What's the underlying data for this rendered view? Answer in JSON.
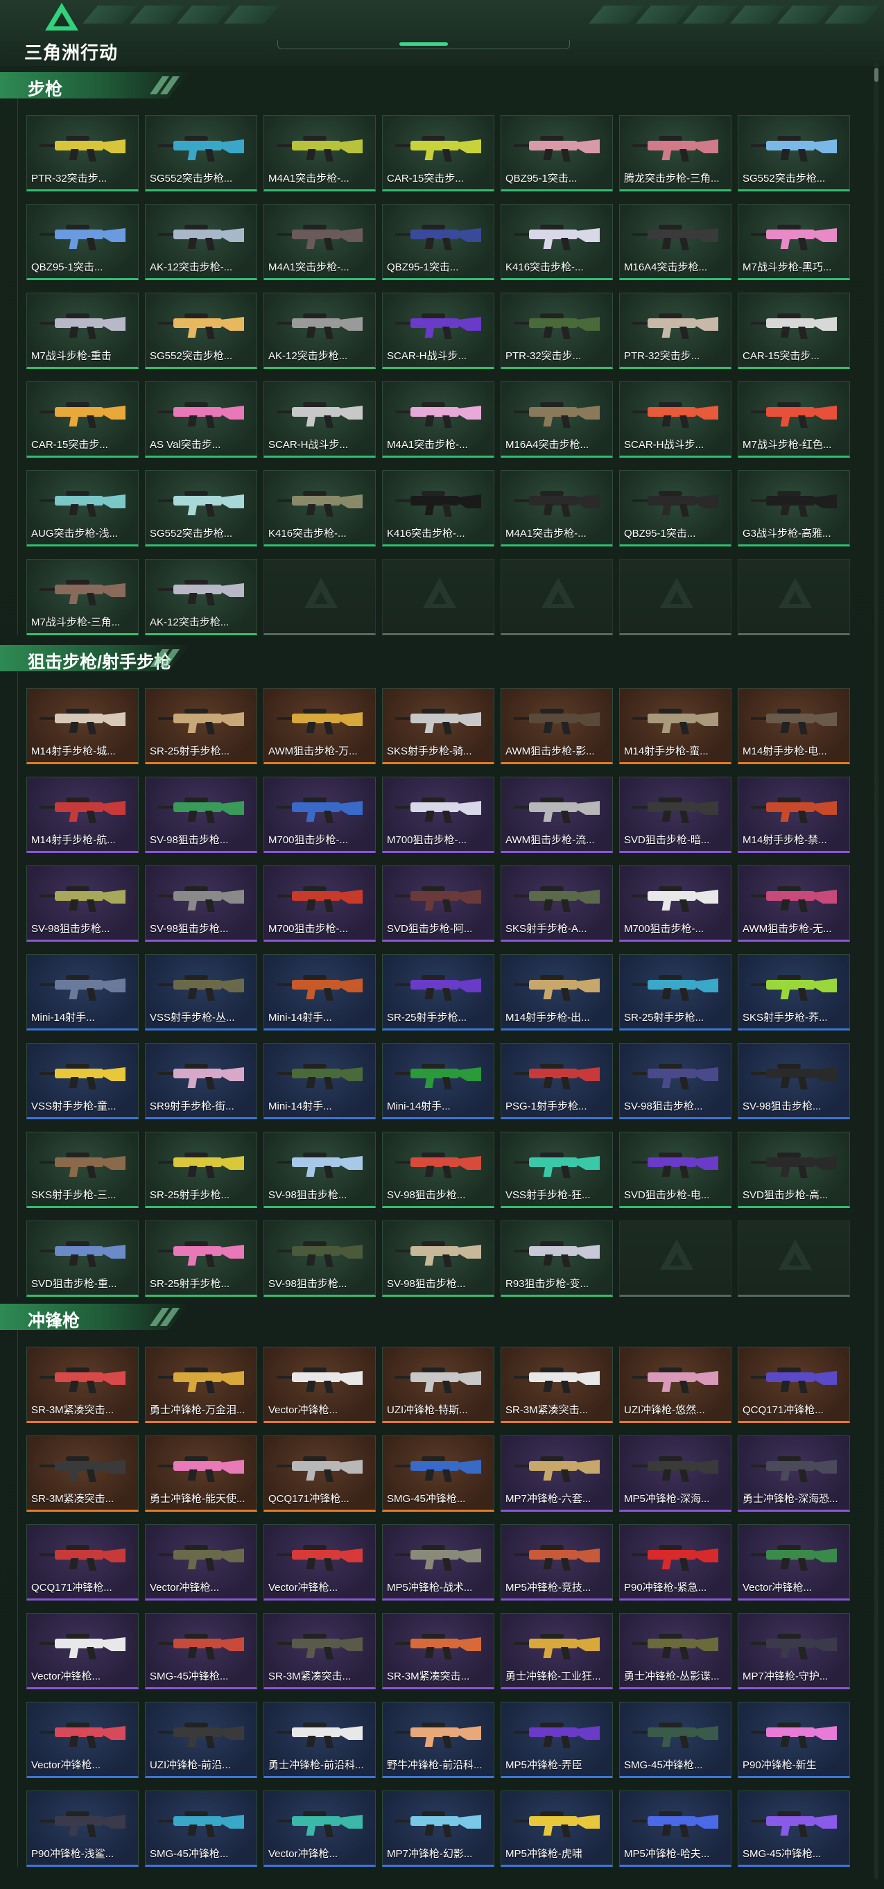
{
  "header": {
    "game_title": "三角洲行动",
    "logo_icon": "delta-triangle-logo-icon"
  },
  "colors": {
    "green": "#2fbf71",
    "orange": "#e67a23",
    "purple": "#8c55d8",
    "blue": "#3a76d8",
    "accent": "#33d17c"
  },
  "sections": [
    {
      "title": "步枪",
      "items": [
        {
          "name": "PTR-32突击步...",
          "rarity": "green",
          "color": "#d8c53a"
        },
        {
          "name": "SG552突击步枪...",
          "rarity": "green",
          "color": "#3aa7c8"
        },
        {
          "name": "M4A1突击步枪-...",
          "rarity": "green",
          "color": "#b8c23a"
        },
        {
          "name": "CAR-15突击步...",
          "rarity": "green",
          "color": "#c8d23a"
        },
        {
          "name": "QBZ95-1突击...",
          "rarity": "green",
          "color": "#d89aa8"
        },
        {
          "name": "腾龙突击步枪-三角...",
          "rarity": "green",
          "color": "#d07a8a"
        },
        {
          "name": "SG552突击步枪...",
          "rarity": "green",
          "color": "#7ab8e8"
        },
        {
          "name": "QBZ95-1突击...",
          "rarity": "green",
          "color": "#6a9ae0"
        },
        {
          "name": "AK-12突击步枪-...",
          "rarity": "green",
          "color": "#a8b8c8"
        },
        {
          "name": "M4A1突击步枪-...",
          "rarity": "green",
          "color": "#6a5a5a"
        },
        {
          "name": "QBZ95-1突击...",
          "rarity": "green",
          "color": "#3a4a9a"
        },
        {
          "name": "K416突击步枪-...",
          "rarity": "green",
          "color": "#d8d8e8"
        },
        {
          "name": "M16A4突击步枪...",
          "rarity": "green",
          "color": "#3a3a3a"
        },
        {
          "name": "M7战斗步枪-黑巧...",
          "rarity": "green",
          "color": "#e88ac8"
        },
        {
          "name": "M7战斗步枪-重击",
          "rarity": "green",
          "color": "#b8b8c8"
        },
        {
          "name": "SG552突击步枪...",
          "rarity": "green",
          "color": "#e8b860"
        },
        {
          "name": "AK-12突击步枪...",
          "rarity": "green",
          "color": "#9a9a9a"
        },
        {
          "name": "SCAR-H战斗步...",
          "rarity": "green",
          "color": "#6a3ac8"
        },
        {
          "name": "PTR-32突击步...",
          "rarity": "green",
          "color": "#4a6a3a"
        },
        {
          "name": "PTR-32突击步...",
          "rarity": "green",
          "color": "#c8b8a8"
        },
        {
          "name": "CAR-15突击步...",
          "rarity": "green",
          "color": "#d8d8d8"
        },
        {
          "name": "CAR-15突击步...",
          "rarity": "green",
          "color": "#e8a83a"
        },
        {
          "name": "AS Val突击步...",
          "rarity": "green",
          "color": "#e878b8"
        },
        {
          "name": "SCAR-H战斗步...",
          "rarity": "green",
          "color": "#c8c8c8"
        },
        {
          "name": "M4A1突击步枪-...",
          "rarity": "green",
          "color": "#e8a8d8"
        },
        {
          "name": "M16A4突击步枪...",
          "rarity": "green",
          "color": "#8a7a5a"
        },
        {
          "name": "SCAR-H战斗步...",
          "rarity": "green",
          "color": "#e85a3a"
        },
        {
          "name": "M7战斗步枪-红色...",
          "rarity": "green",
          "color": "#e8503a"
        },
        {
          "name": "AUG突击步枪-浅...",
          "rarity": "green",
          "color": "#7ac8c8"
        },
        {
          "name": "SG552突击步枪...",
          "rarity": "green",
          "color": "#a8d8d8"
        },
        {
          "name": "K416突击步枪-...",
          "rarity": "green",
          "color": "#8a8a6a"
        },
        {
          "name": "K416突击步枪-...",
          "rarity": "green",
          "color": "#1a1a1a"
        },
        {
          "name": "M4A1突击步枪-...",
          "rarity": "green",
          "color": "#2a2a2a"
        },
        {
          "name": "QBZ95-1突击...",
          "rarity": "green",
          "color": "#2a2a2a"
        },
        {
          "name": "G3战斗步枪-高雅...",
          "rarity": "green",
          "color": "#1e1e1e"
        },
        {
          "name": "M7战斗步枪-三角...",
          "rarity": "green",
          "color": "#8a6a5a"
        },
        {
          "name": "AK-12突击步枪...",
          "rarity": "green",
          "color": "#b8b8c8"
        },
        {
          "empty": true
        },
        {
          "empty": true
        },
        {
          "empty": true
        },
        {
          "empty": true
        },
        {
          "empty": true
        }
      ]
    },
    {
      "title": "狙击步枪/射手步枪",
      "items": [
        {
          "name": "M14射手步枪-城...",
          "rarity": "orange",
          "color": "#d8c8b8"
        },
        {
          "name": "SR-25射手步枪...",
          "rarity": "orange",
          "color": "#c8a878"
        },
        {
          "name": "AWM狙击步枪-万...",
          "rarity": "orange",
          "color": "#d8a83a"
        },
        {
          "name": "SKS射手步枪-骑...",
          "rarity": "orange",
          "color": "#c8c8c8"
        },
        {
          "name": "AWM狙击步枪-影...",
          "rarity": "orange",
          "color": "#5a4a3a"
        },
        {
          "name": "M14射手步枪-蛮...",
          "rarity": "orange",
          "color": "#a89a7a"
        },
        {
          "name": "M14射手步枪-电...",
          "rarity": "orange",
          "color": "#6a5a4a"
        },
        {
          "name": "M14射手步枪-航...",
          "rarity": "purple",
          "color": "#c83a3a"
        },
        {
          "name": "SV-98狙击步枪...",
          "rarity": "purple",
          "color": "#3a9a5a"
        },
        {
          "name": "M700狙击步枪-...",
          "rarity": "purple",
          "color": "#3a6ac8"
        },
        {
          "name": "M700狙击步枪-...",
          "rarity": "purple",
          "color": "#d8d8e8"
        },
        {
          "name": "AWM狙击步枪-流...",
          "rarity": "purple",
          "color": "#b8b8b8"
        },
        {
          "name": "SVD狙击步枪-暗...",
          "rarity": "purple",
          "color": "#3a3a3a"
        },
        {
          "name": "M14射手步枪-禁...",
          "rarity": "purple",
          "color": "#c84a2a"
        },
        {
          "name": "SV-98狙击步枪...",
          "rarity": "purple",
          "color": "#a8a85a"
        },
        {
          "name": "SV-98狙击步枪...",
          "rarity": "purple",
          "color": "#8a8a8a"
        },
        {
          "name": "M700狙击步枪-...",
          "rarity": "purple",
          "color": "#c83a2a"
        },
        {
          "name": "SVD狙击步枪-阿...",
          "rarity": "purple",
          "color": "#6a3a3a"
        },
        {
          "name": "SKS射手步枪-A...",
          "rarity": "purple",
          "color": "#5a6a4a"
        },
        {
          "name": "M700狙击步枪-...",
          "rarity": "purple",
          "color": "#e8e8e8"
        },
        {
          "name": "AWM狙击步枪-无...",
          "rarity": "purple",
          "color": "#c84a7a"
        },
        {
          "name": "Mini-14射手...",
          "rarity": "blue",
          "color": "#6a7a9a"
        },
        {
          "name": "VSS射手步枪-丛...",
          "rarity": "blue",
          "color": "#6a6a4a"
        },
        {
          "name": "Mini-14射手...",
          "rarity": "blue",
          "color": "#c85a2a"
        },
        {
          "name": "SR-25射手步枪...",
          "rarity": "blue",
          "color": "#6a3ac8"
        },
        {
          "name": "M14射手步枪-出...",
          "rarity": "blue",
          "color": "#c8a86a"
        },
        {
          "name": "SR-25射手步枪...",
          "rarity": "blue",
          "color": "#3aa8c8"
        },
        {
          "name": "SKS射手步枪-荞...",
          "rarity": "blue",
          "color": "#9ad83a"
        },
        {
          "name": "VSS射手步枪-童...",
          "rarity": "blue",
          "color": "#e8c83a"
        },
        {
          "name": "SR9射手步枪-街...",
          "rarity": "blue",
          "color": "#d8a8c8"
        },
        {
          "name": "Mini-14射手...",
          "rarity": "blue",
          "color": "#4a6a3a"
        },
        {
          "name": "Mini-14射手...",
          "rarity": "blue",
          "color": "#2a9a3a"
        },
        {
          "name": "PSG-1射手步枪...",
          "rarity": "blue",
          "color": "#c83a3a"
        },
        {
          "name": "SV-98狙击步枪...",
          "rarity": "blue",
          "color": "#4a4a8a"
        },
        {
          "name": "SV-98狙击步枪...",
          "rarity": "blue",
          "color": "#2a2a2a"
        },
        {
          "name": "SKS射手步枪-三...",
          "rarity": "green",
          "color": "#8a6a4a"
        },
        {
          "name": "SR-25射手步枪...",
          "rarity": "green",
          "color": "#d8c83a"
        },
        {
          "name": "SV-98狙击步枪...",
          "rarity": "green",
          "color": "#a8c8e8"
        },
        {
          "name": "SV-98狙击步枪...",
          "rarity": "green",
          "color": "#d84a3a"
        },
        {
          "name": "VSS射手步枪-狂...",
          "rarity": "green",
          "color": "#3ac8a8"
        },
        {
          "name": "SVD狙击步枪-电...",
          "rarity": "green",
          "color": "#6a3ac8"
        },
        {
          "name": "SVD狙击步枪-高...",
          "rarity": "green",
          "color": "#2a2a2a"
        },
        {
          "name": "SVD狙击步枪-重...",
          "rarity": "green",
          "color": "#6a8ac8"
        },
        {
          "name": "SR-25射手步枪...",
          "rarity": "green",
          "color": "#e878b8"
        },
        {
          "name": "SV-98狙击步枪...",
          "rarity": "green",
          "color": "#4a5a3a"
        },
        {
          "name": "SV-98狙击步枪...",
          "rarity": "green",
          "color": "#c8b89a"
        },
        {
          "name": "R93狙击步枪-变...",
          "rarity": "green",
          "color": "#c8c8d8"
        },
        {
          "empty": true
        },
        {
          "empty": true
        }
      ]
    },
    {
      "title": "冲锋枪",
      "items": [
        {
          "name": "SR-3M紧凑突击...",
          "rarity": "orange",
          "color": "#d84a4a"
        },
        {
          "name": "勇士冲锋枪-万金泪...",
          "rarity": "orange",
          "color": "#d8a83a"
        },
        {
          "name": "Vector冲锋枪...",
          "rarity": "orange",
          "color": "#e8e8e8"
        },
        {
          "name": "UZI冲锋枪-特斯...",
          "rarity": "orange",
          "color": "#c8c8c8"
        },
        {
          "name": "SR-3M紧凑突击...",
          "rarity": "orange",
          "color": "#e8e8e8"
        },
        {
          "name": "UZI冲锋枪-悠然...",
          "rarity": "orange",
          "color": "#d89ab8"
        },
        {
          "name": "QCQ171冲锋枪...",
          "rarity": "orange",
          "color": "#5a4ac8"
        },
        {
          "name": "SR-3M紧凑突击...",
          "rarity": "orange",
          "color": "#3a3a3a"
        },
        {
          "name": "勇士冲锋枪-能天使...",
          "rarity": "orange",
          "color": "#e87ab8"
        },
        {
          "name": "QCQ171冲锋枪...",
          "rarity": "orange",
          "color": "#b8b8b8"
        },
        {
          "name": "SMG-45冲锋枪...",
          "rarity": "orange",
          "color": "#3a6ac8"
        },
        {
          "name": "MP7冲锋枪-六套...",
          "rarity": "purple",
          "color": "#c8a86a"
        },
        {
          "name": "MP5冲锋枪-深海...",
          "rarity": "purple",
          "color": "#3a3a3a"
        },
        {
          "name": "勇士冲锋枪-深海恐...",
          "rarity": "purple",
          "color": "#4a4a5a"
        },
        {
          "name": "QCQ171冲锋枪...",
          "rarity": "purple",
          "color": "#c83a3a"
        },
        {
          "name": "Vector冲锋枪...",
          "rarity": "purple",
          "color": "#6a6a4a"
        },
        {
          "name": "Vector冲锋枪...",
          "rarity": "purple",
          "color": "#d83a3a"
        },
        {
          "name": "MP5冲锋枪-战术...",
          "rarity": "purple",
          "color": "#8a8a7a"
        },
        {
          "name": "MP5冲锋枪-竞技...",
          "rarity": "purple",
          "color": "#c85a3a"
        },
        {
          "name": "P90冲锋枪-紧急...",
          "rarity": "purple",
          "color": "#d82a2a"
        },
        {
          "name": "Vector冲锋枪...",
          "rarity": "purple",
          "color": "#3a8a4a"
        },
        {
          "name": "Vector冲锋枪...",
          "rarity": "purple",
          "color": "#e8e8e8"
        },
        {
          "name": "SMG-45冲锋枪...",
          "rarity": "purple",
          "color": "#c84a3a"
        },
        {
          "name": "SR-3M紧凑突击...",
          "rarity": "purple",
          "color": "#5a5a4a"
        },
        {
          "name": "SR-3M紧凑突击...",
          "rarity": "purple",
          "color": "#d86a3a"
        },
        {
          "name": "勇士冲锋枪-工业狂...",
          "rarity": "purple",
          "color": "#d8a83a"
        },
        {
          "name": "勇士冲锋枪-丛影谍...",
          "rarity": "purple",
          "color": "#6a6a3a"
        },
        {
          "name": "MP7冲锋枪-守护...",
          "rarity": "purple",
          "color": "#3a3a4a"
        },
        {
          "name": "Vector冲锋枪...",
          "rarity": "blue",
          "color": "#d84a5a"
        },
        {
          "name": "UZI冲锋枪-前沿...",
          "rarity": "blue",
          "color": "#3a3a3a"
        },
        {
          "name": "勇士冲锋枪-前沿科...",
          "rarity": "blue",
          "color": "#e8e8e8"
        },
        {
          "name": "野牛冲锋枪-前沿科...",
          "rarity": "blue",
          "color": "#e8a87a"
        },
        {
          "name": "MP5冲锋枪-弄臣",
          "rarity": "blue",
          "color": "#6a3ac8"
        },
        {
          "name": "SMG-45冲锋枪...",
          "rarity": "blue",
          "color": "#3a5a4a"
        },
        {
          "name": "P90冲锋枪-新生",
          "rarity": "blue",
          "color": "#e87ad8"
        },
        {
          "name": "P90冲锋枪-浅鲨...",
          "rarity": "blue",
          "color": "#3a3a4a"
        },
        {
          "name": "SMG-45冲锋枪...",
          "rarity": "blue",
          "color": "#3aa8c8"
        },
        {
          "name": "Vector冲锋枪...",
          "rarity": "blue",
          "color": "#3ab8a8"
        },
        {
          "name": "MP7冲锋枪-幻影...",
          "rarity": "blue",
          "color": "#7ac8e8"
        },
        {
          "name": "MP5冲锋枪-虎啸",
          "rarity": "blue",
          "color": "#e8c83a"
        },
        {
          "name": "MP5冲锋枪-哈夫...",
          "rarity": "blue",
          "color": "#4a6ae8"
        },
        {
          "name": "SMG-45冲锋枪...",
          "rarity": "blue",
          "color": "#8a5ae8"
        }
      ]
    }
  ]
}
